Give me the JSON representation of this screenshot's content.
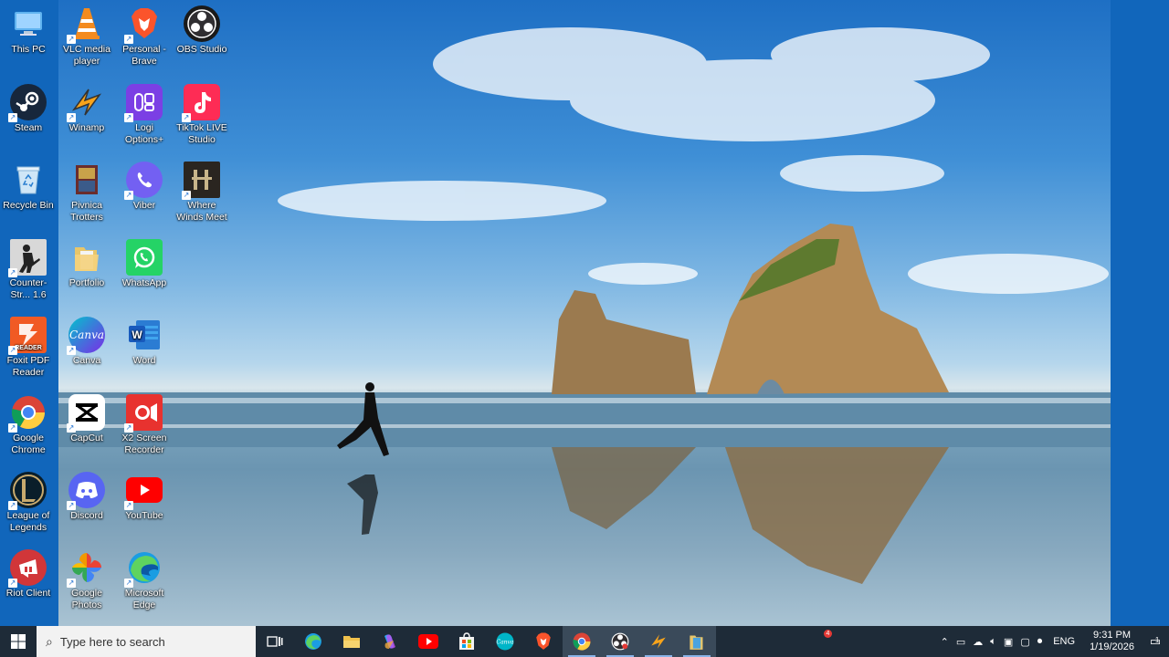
{
  "desktop_icons": [
    {
      "label": "This PC"
    },
    {
      "label": "Steam"
    },
    {
      "label": "Recycle Bin"
    },
    {
      "label": "Counter-Str... 1.6"
    },
    {
      "label": "Foxit PDF Reader"
    },
    {
      "label": "Google Chrome"
    },
    {
      "label": "League of Legends"
    },
    {
      "label": "Riot Client"
    },
    {
      "label": "VLC media player"
    },
    {
      "label": "Winamp"
    },
    {
      "label": "Pivnica Trotters"
    },
    {
      "label": "Portfolio"
    },
    {
      "label": "Canva"
    },
    {
      "label": "CapCut"
    },
    {
      "label": "Discord"
    },
    {
      "label": "Google Photos"
    },
    {
      "label": "Personal - Brave"
    },
    {
      "label": "Logi Options+"
    },
    {
      "label": "Viber"
    },
    {
      "label": "WhatsApp"
    },
    {
      "label": "Word"
    },
    {
      "label": "X2 Screen Recorder"
    },
    {
      "label": "YouTube"
    },
    {
      "label": "Microsoft Edge"
    },
    {
      "label": "OBS Studio"
    },
    {
      "label": "TikTok LIVE Studio"
    },
    {
      "label": "Where Winds Meet"
    }
  ],
  "taskbar": {
    "search_placeholder": "Type here to search",
    "apps": [
      "task-view",
      "edge",
      "file-explorer",
      "copilot",
      "youtube",
      "store",
      "canva",
      "brave",
      "chrome",
      "obs",
      "winamp",
      "folder"
    ],
    "notification_count": "4",
    "tray": {
      "language": "ENG",
      "time": "9:31 PM",
      "date": "1/19/2026",
      "notifications": "1"
    }
  }
}
